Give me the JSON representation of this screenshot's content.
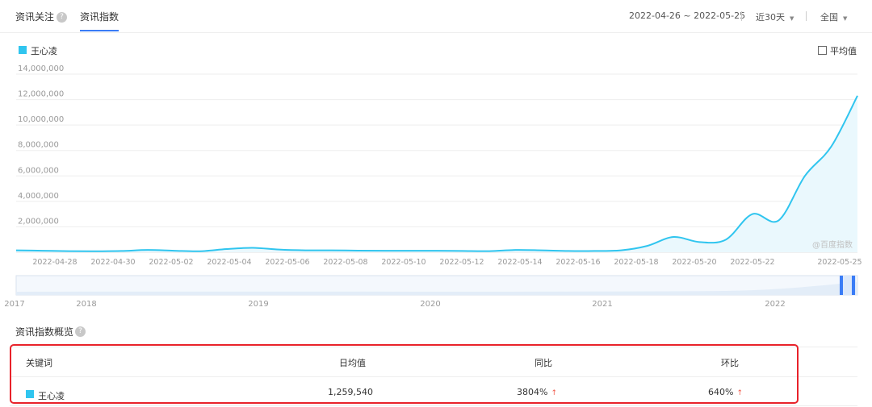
{
  "tabs": [
    {
      "label": "资讯关注"
    },
    {
      "label": "资讯指数"
    }
  ],
  "help_icon": "?",
  "toolbar": {
    "date_range": "2022-04-26 ~ 2022-05-25",
    "period": "近30天",
    "region": "全国"
  },
  "legend": {
    "label": "王心凌",
    "color": "#30c5ef"
  },
  "average_toggle": {
    "label": "平均值"
  },
  "watermark": "@百度指数",
  "chart_data": {
    "type": "area",
    "series": [
      {
        "name": "王心凌",
        "color": "#30c5ef",
        "values": [
          150000,
          120000,
          90000,
          80000,
          100000,
          180000,
          120000,
          80000,
          250000,
          350000,
          210000,
          150000,
          150000,
          130000,
          120000,
          120000,
          120000,
          100000,
          90000,
          180000,
          150000,
          100000,
          100000,
          150000,
          500000,
          1200000,
          800000,
          1000000,
          3000000,
          2500000,
          6000000,
          8300000,
          12300000
        ]
      }
    ],
    "x_tick_labels": [
      "2022-04-28",
      "2022-04-30",
      "2022-05-02",
      "2022-05-04",
      "2022-05-06",
      "2022-05-08",
      "2022-05-10",
      "2022-05-12",
      "2022-05-14",
      "2022-05-16",
      "2022-05-18",
      "2022-05-20",
      "2022-05-22",
      "2022-05-25"
    ],
    "y_tick_labels": [
      "2,000,000",
      "4,000,000",
      "6,000,000",
      "8,000,000",
      "10,000,000",
      "12,000,000",
      "14,000,000"
    ],
    "ylim": [
      0,
      14000000
    ],
    "grid": true,
    "legend_position": "top-left"
  },
  "timeline": {
    "year_labels": [
      "2017",
      "2018",
      "2019",
      "2020",
      "2021",
      "2022"
    ]
  },
  "overview": {
    "title": "资讯指数概览",
    "headers": {
      "keyword": "关键词",
      "daily_avg": "日均值",
      "yoy": "同比",
      "mom": "环比"
    },
    "row": {
      "keyword": "王心凌",
      "daily_avg": "1,259,540",
      "yoy": "3804%",
      "mom": "640%"
    },
    "up_arrow": "↑"
  },
  "colors": {
    "accent": "#3a7cf6",
    "series": "#30c5ef",
    "highlight": "#e8222a",
    "up": "#f05a4a"
  }
}
